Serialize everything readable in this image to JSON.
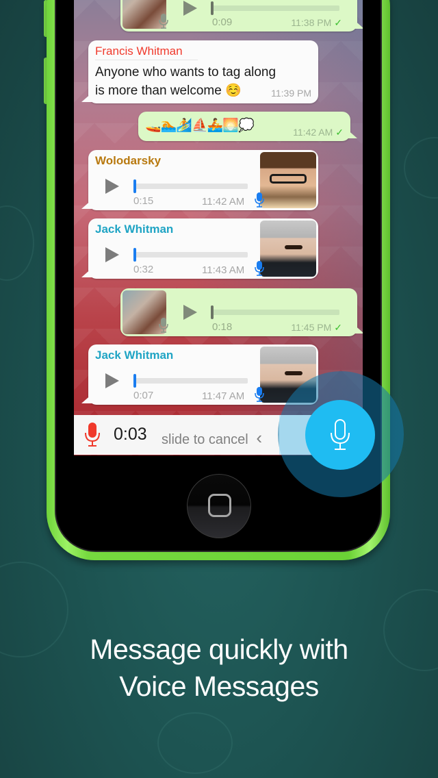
{
  "colors": {
    "background": "#1d5452",
    "phone_body": "#76d93f",
    "bubble_incoming": "#fbfbfb",
    "bubble_outgoing": "#dcf8c6",
    "sender_francis": "#f0392b",
    "sender_wolodarsky": "#b8790f",
    "sender_jack": "#1fa4c4",
    "record_button": "#1fbcf2",
    "record_mic": "#f0392b",
    "read_check": "#3cbf2f",
    "voice_progress": "#1a7df0"
  },
  "chat": {
    "messages": [
      {
        "type": "voice",
        "direction": "outgoing",
        "duration": "0:09",
        "time": "11:38 PM",
        "status": "✓",
        "avatar": "woman-in-hood-photo"
      },
      {
        "type": "text",
        "direction": "incoming",
        "sender": "Francis Whitman",
        "lines": [
          "Anyone who wants to tag along",
          "is more than welcome ☺️"
        ],
        "time": "11:39 PM"
      },
      {
        "type": "emoji",
        "direction": "outgoing",
        "content": "🚤🏊🏄⛵🚣🌅💭",
        "time": "11:42 AM",
        "status": "✓"
      },
      {
        "type": "voice",
        "direction": "incoming",
        "sender": "Wolodarsky",
        "duration": "0:15",
        "time": "11:42 AM",
        "avatar": "man-with-glasses-photo"
      },
      {
        "type": "voice",
        "direction": "incoming",
        "sender": "Jack Whitman",
        "duration": "0:32",
        "time": "11:43 AM",
        "avatar": "man-with-pipe-photo"
      },
      {
        "type": "voice",
        "direction": "outgoing",
        "duration": "0:18",
        "time": "11:45 PM",
        "status": "✓",
        "avatar": "woman-in-hood-photo"
      },
      {
        "type": "voice",
        "direction": "incoming",
        "sender": "Jack Whitman",
        "duration": "0:07",
        "time": "11:47 AM",
        "avatar": "man-with-pipe-photo"
      }
    ]
  },
  "recording": {
    "elapsed": "0:03",
    "hint": "slide to cancel",
    "chevron": "‹",
    "icon": "microphone-icon"
  },
  "caption": {
    "line1": "Message quickly with",
    "line2": "Voice Messages"
  }
}
